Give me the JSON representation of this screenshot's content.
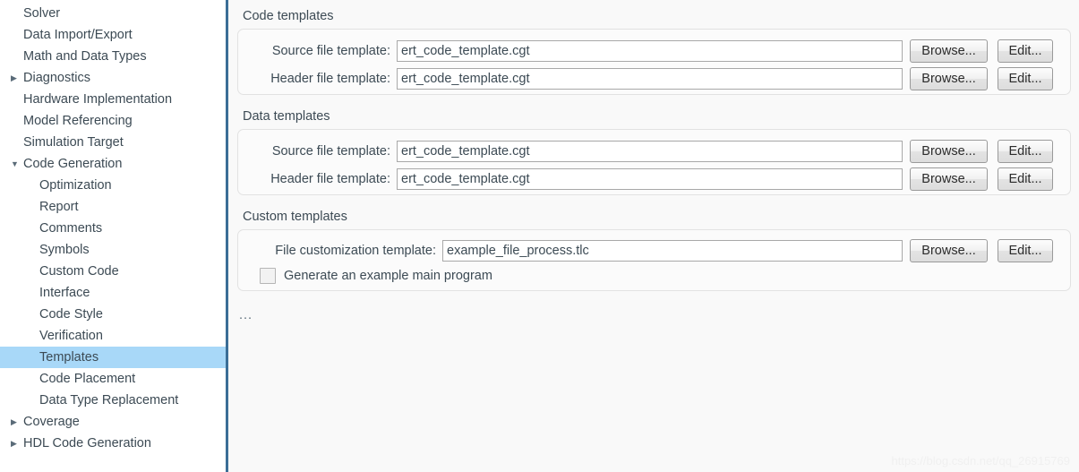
{
  "sidebar": {
    "items": [
      {
        "label": "Solver",
        "level": 0,
        "arrow": "none",
        "selected": false
      },
      {
        "label": "Data Import/Export",
        "level": 0,
        "arrow": "none",
        "selected": false
      },
      {
        "label": "Math and Data Types",
        "level": 0,
        "arrow": "none",
        "selected": false
      },
      {
        "label": "Diagnostics",
        "level": 0,
        "arrow": "collapsed",
        "selected": false
      },
      {
        "label": "Hardware Implementation",
        "level": 0,
        "arrow": "none",
        "selected": false
      },
      {
        "label": "Model Referencing",
        "level": 0,
        "arrow": "none",
        "selected": false
      },
      {
        "label": "Simulation Target",
        "level": 0,
        "arrow": "none",
        "selected": false
      },
      {
        "label": "Code Generation",
        "level": 0,
        "arrow": "expanded",
        "selected": false
      },
      {
        "label": "Optimization",
        "level": 1,
        "arrow": "none",
        "selected": false
      },
      {
        "label": "Report",
        "level": 1,
        "arrow": "none",
        "selected": false
      },
      {
        "label": "Comments",
        "level": 1,
        "arrow": "none",
        "selected": false
      },
      {
        "label": "Symbols",
        "level": 1,
        "arrow": "none",
        "selected": false
      },
      {
        "label": "Custom Code",
        "level": 1,
        "arrow": "none",
        "selected": false
      },
      {
        "label": "Interface",
        "level": 1,
        "arrow": "none",
        "selected": false
      },
      {
        "label": "Code Style",
        "level": 1,
        "arrow": "none",
        "selected": false
      },
      {
        "label": "Verification",
        "level": 1,
        "arrow": "none",
        "selected": false
      },
      {
        "label": "Templates",
        "level": 1,
        "arrow": "none",
        "selected": true
      },
      {
        "label": "Code Placement",
        "level": 1,
        "arrow": "none",
        "selected": false
      },
      {
        "label": "Data Type Replacement",
        "level": 1,
        "arrow": "none",
        "selected": false
      },
      {
        "label": "Coverage",
        "level": 0,
        "arrow": "collapsed",
        "selected": false
      },
      {
        "label": "HDL Code Generation",
        "level": 0,
        "arrow": "collapsed",
        "selected": false
      }
    ],
    "arrow_glyphs": {
      "collapsed": "▶",
      "expanded": "▼",
      "none": ""
    },
    "selected_color": "#a8d8f8",
    "border_color": "#3b6e96"
  },
  "main": {
    "groups": [
      {
        "title": "Code templates",
        "rows": [
          {
            "label": "Source file template:",
            "value": "ert_code_template.cgt",
            "browse": "Browse...",
            "edit": "Edit..."
          },
          {
            "label": "Header file template:",
            "value": "ert_code_template.cgt",
            "browse": "Browse...",
            "edit": "Edit..."
          }
        ]
      },
      {
        "title": "Data templates",
        "rows": [
          {
            "label": "Source file template:",
            "value": "ert_code_template.cgt",
            "browse": "Browse...",
            "edit": "Edit..."
          },
          {
            "label": "Header file template:",
            "value": "ert_code_template.cgt",
            "browse": "Browse...",
            "edit": "Edit..."
          }
        ]
      },
      {
        "title": "Custom templates",
        "rows": [
          {
            "label": "File customization template:",
            "value": "example_file_process.tlc",
            "browse": "Browse...",
            "edit": "Edit..."
          }
        ],
        "checkbox": {
          "label": "Generate an example main program",
          "checked": false
        }
      }
    ],
    "ellipsis": "...",
    "watermark": "https://blog.csdn.net/qq_26915769"
  }
}
